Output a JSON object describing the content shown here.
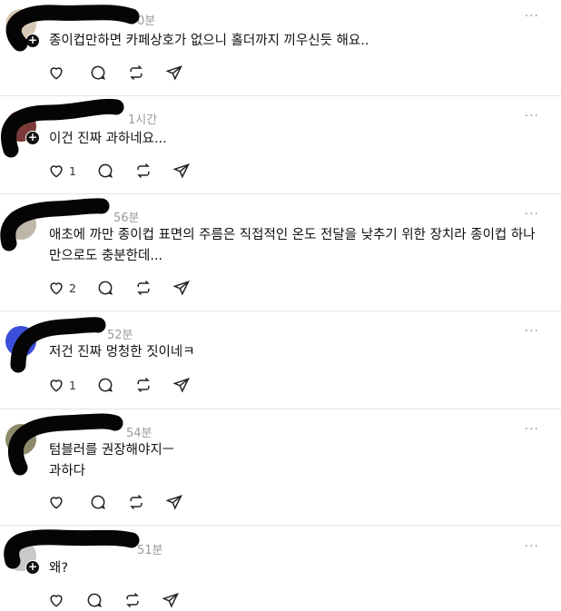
{
  "icons": {
    "like": "heart-icon",
    "comment": "comment-icon",
    "repost": "repost-icon",
    "share": "share-icon",
    "more": "more-icon"
  },
  "more_label": "···",
  "replies": [
    {
      "time": "0분",
      "text": "종이컵만하면 카페상호가 없으니 홀더까지 끼우신듯 해요..",
      "likes": ""
    },
    {
      "time": "1시간",
      "text": "이건 진짜 과하네요...",
      "likes": "1"
    },
    {
      "time": "56분",
      "text": "애초에 까만 종이컵 표면의 주름은 직접적인 온도 전달을 낮추기 위한 장치라 종이컵 하나만으로도 충분한데...",
      "likes": "2"
    },
    {
      "time": "52분",
      "text": "저건 진짜 멍청한 짓이네ㅋ",
      "likes": "1"
    },
    {
      "time": "54분",
      "text": "텀블러를 권장해야지ㅡ\n과하다",
      "likes": ""
    },
    {
      "time": "51분",
      "text": "왜?",
      "likes": ""
    }
  ]
}
